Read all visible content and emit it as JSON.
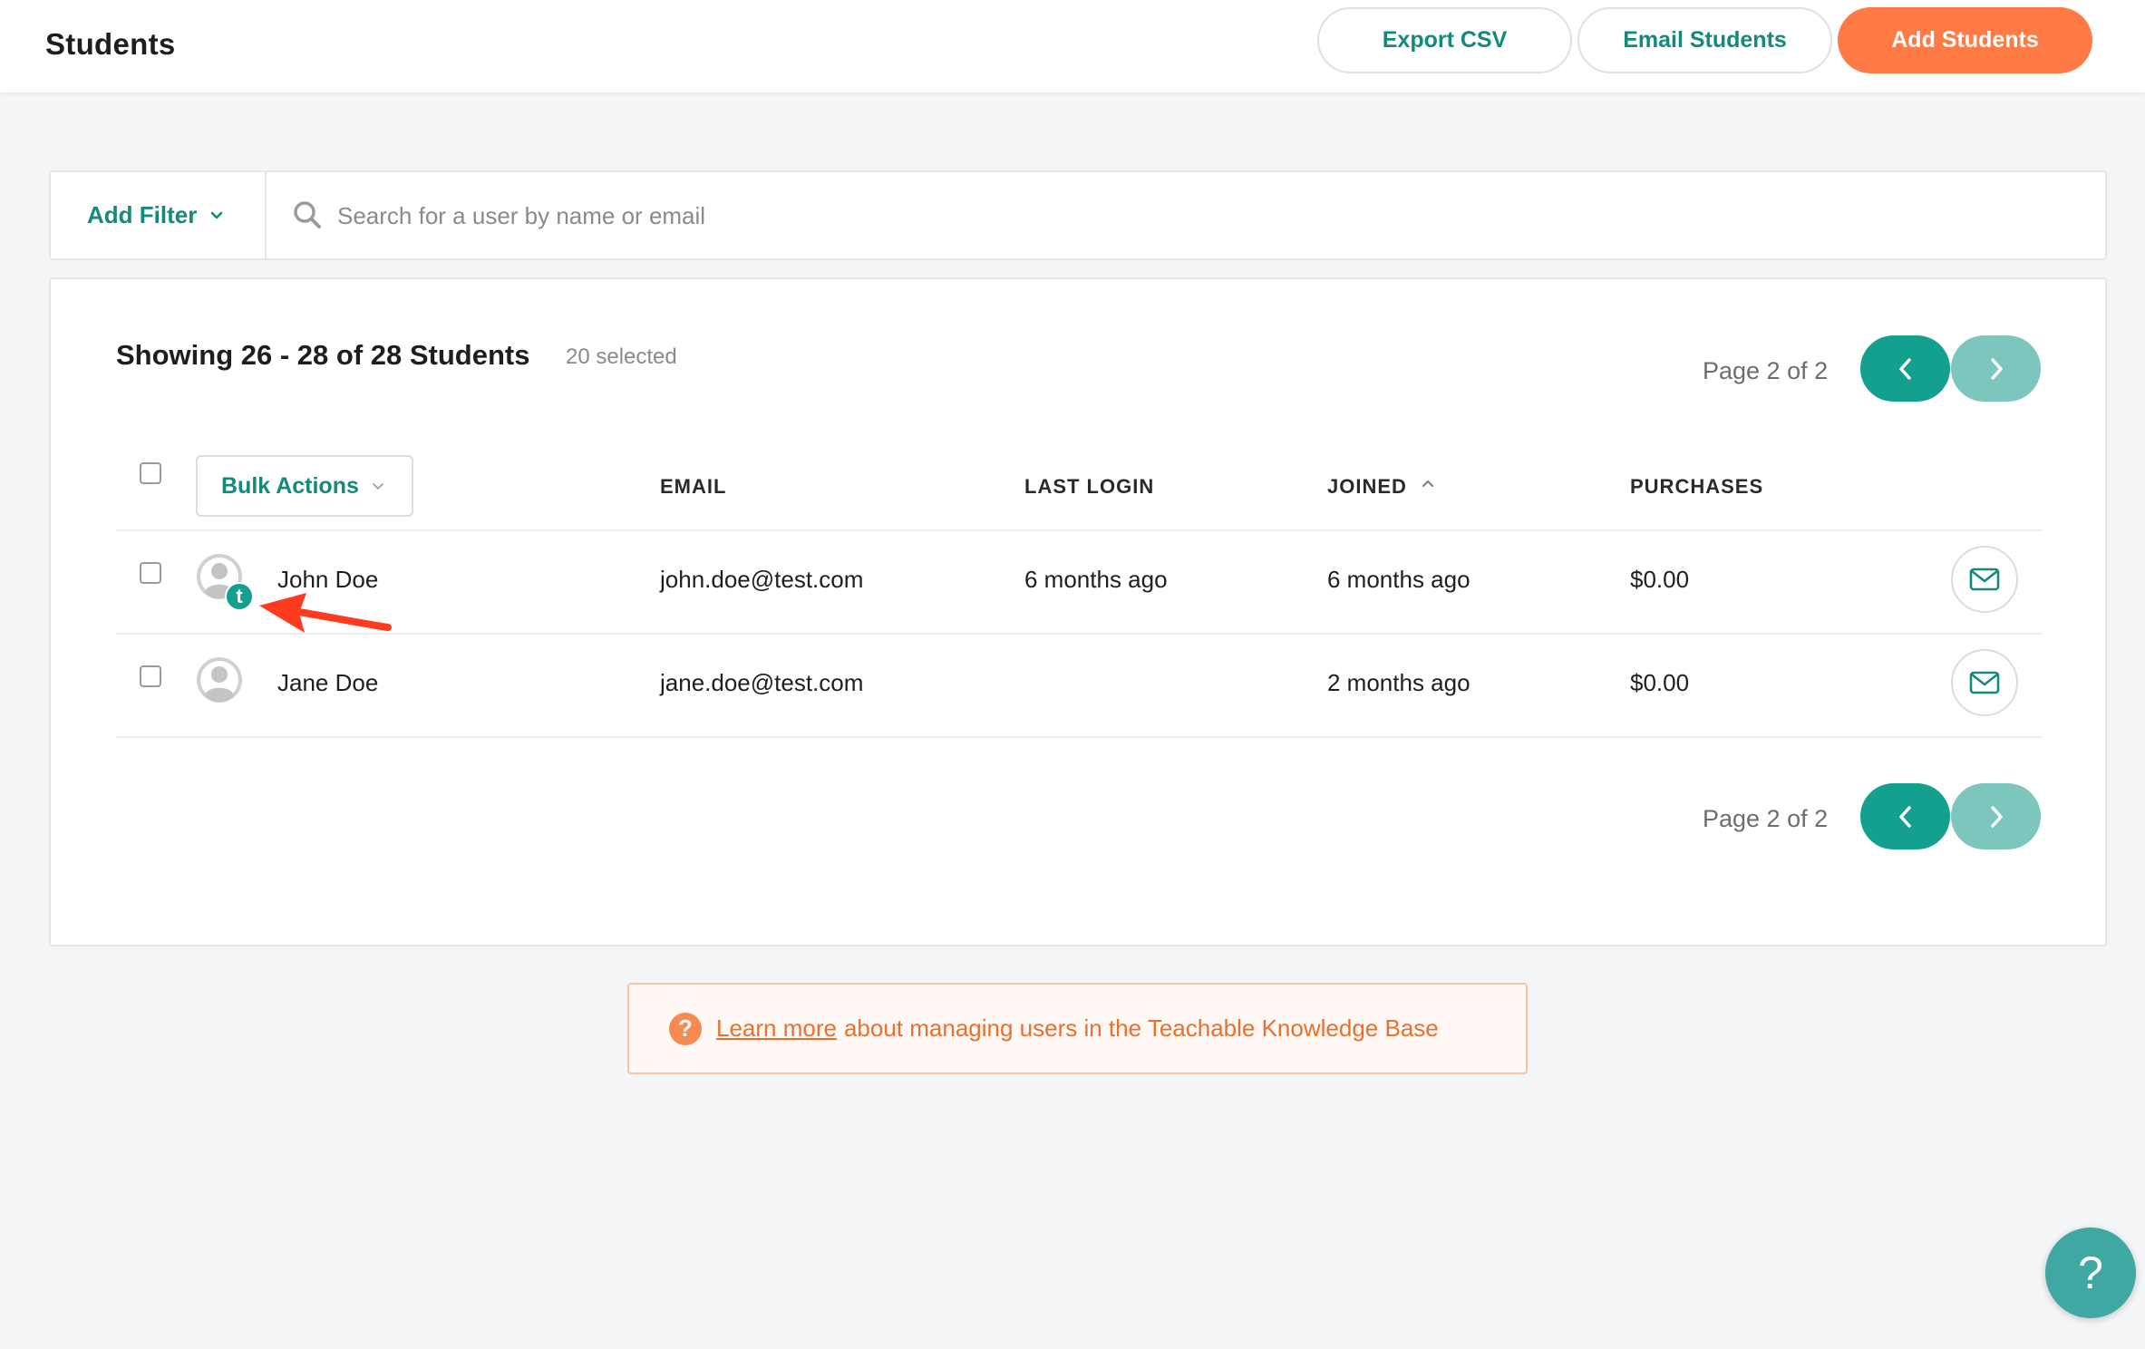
{
  "header": {
    "title": "Students",
    "export_label": "Export CSV",
    "email_label": "Email Students",
    "add_label": "Add Students"
  },
  "filter": {
    "add_filter_label": "Add Filter",
    "search_placeholder": "Search for a user by name or email"
  },
  "summary": {
    "showing": "Showing 26 - 28 of 28 Students",
    "selected": "20 selected",
    "page_label": "Page 2 of 2"
  },
  "table": {
    "bulk_actions_label": "Bulk Actions",
    "columns": {
      "email": "EMAIL",
      "last_login": "LAST LOGIN",
      "joined": "JOINED",
      "purchases": "PURCHASES"
    },
    "rows": [
      {
        "name": "John Doe",
        "email": "john.doe@test.com",
        "last_login": "6 months ago",
        "joined": "6 months ago",
        "purchases": "$0.00",
        "badge": "t"
      },
      {
        "name": "Jane Doe",
        "email": "jane.doe@test.com",
        "last_login": "",
        "joined": "2 months ago",
        "purchases": "$0.00"
      }
    ]
  },
  "knowledge_base": {
    "link_text": "Learn more",
    "text": "about managing users in the Teachable Knowledge Base",
    "icon": "?"
  },
  "help": {
    "icon": "?"
  },
  "icons": {
    "search": "search-icon",
    "prev": "chevron-left-icon",
    "next": "chevron-right-icon",
    "mail": "envelope-icon",
    "sort": "chevron-up-icon"
  },
  "colors": {
    "teal": "#148a7c",
    "teal_button": "#14a08e",
    "teal_light": "#7cc6bd",
    "orange": "#ff7a45",
    "annotation": "#ff3b1f"
  }
}
